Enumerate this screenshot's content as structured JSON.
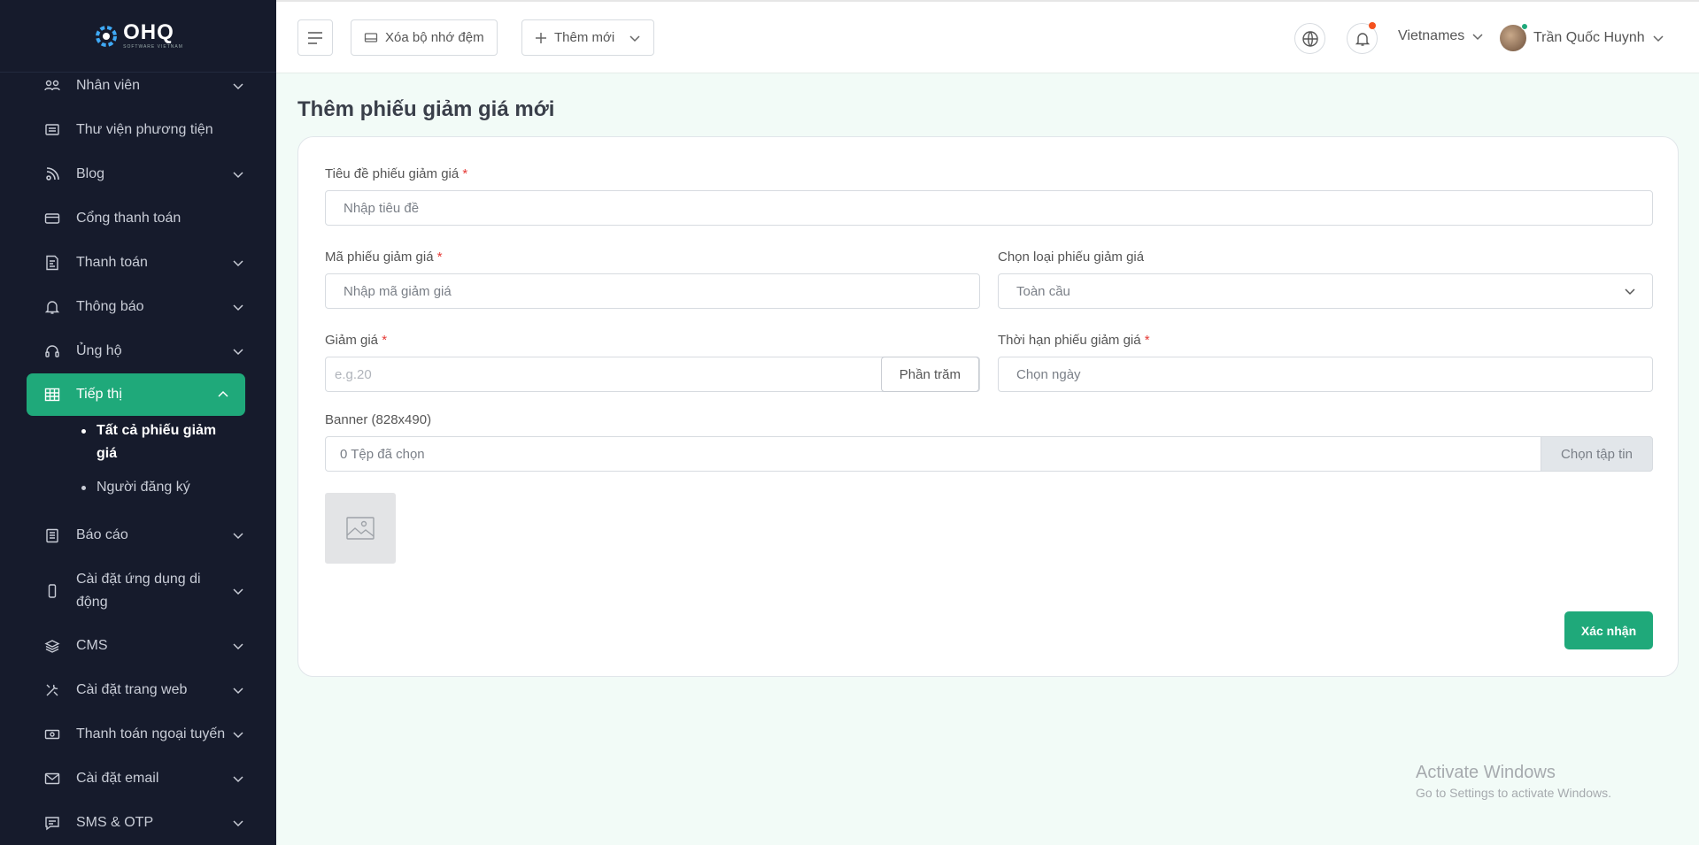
{
  "app": {
    "logo_text": "OHQ",
    "logo_sub": "SOFTWARE VIETNAM"
  },
  "sidebar": {
    "items": [
      {
        "label": "Nhân viên",
        "icon": "users-icon",
        "has_chevron": true
      },
      {
        "label": "Thư viện phương tiện",
        "icon": "media-library-icon",
        "has_chevron": false
      },
      {
        "label": "Blog",
        "icon": "blog-icon",
        "has_chevron": true
      },
      {
        "label": "Cổng thanh toán",
        "icon": "credit-card-icon",
        "has_chevron": false
      },
      {
        "label": "Thanh toán",
        "icon": "invoice-icon",
        "has_chevron": true
      },
      {
        "label": "Thông báo",
        "icon": "bell-icon",
        "has_chevron": true
      },
      {
        "label": "Ủng hộ",
        "icon": "headset-icon",
        "has_chevron": true
      },
      {
        "label": "Tiếp thị",
        "icon": "table-icon",
        "has_chevron": true,
        "active": true
      },
      {
        "label": "Báo cáo",
        "icon": "clipboard-icon",
        "has_chevron": true
      },
      {
        "label": "Cài đặt ứng dụng di động",
        "icon": "mobile-icon",
        "has_chevron": true
      },
      {
        "label": "CMS",
        "icon": "layers-icon",
        "has_chevron": true
      },
      {
        "label": "Cài đặt trang web",
        "icon": "tools-icon",
        "has_chevron": true
      },
      {
        "label": "Thanh toán ngoại tuyến",
        "icon": "cash-icon",
        "has_chevron": true
      },
      {
        "label": "Cài đặt email",
        "icon": "mail-icon",
        "has_chevron": true
      },
      {
        "label": "SMS & OTP",
        "icon": "message-icon",
        "has_chevron": true
      }
    ],
    "submenu": [
      {
        "label": "Tất cả phiếu giảm giá",
        "active": true
      },
      {
        "label": "Người đăng ký",
        "active": false
      }
    ]
  },
  "topbar": {
    "clear_cache_label": "Xóa bộ nhớ đệm",
    "add_new_label": "Thêm mới",
    "language": "Vietnames",
    "user_name": "Trần Quốc Huynh"
  },
  "page": {
    "title": "Thêm phiếu giảm giá mới"
  },
  "form": {
    "title_label": "Tiêu đề phiếu giảm giá",
    "title_placeholder": "Nhập tiêu đề",
    "code_label": "Mã phiếu giảm giá",
    "code_placeholder": "Nhập mã giảm giá",
    "type_label": "Chọn loại phiếu giảm giá",
    "type_value": "Toàn cầu",
    "discount_label": "Giảm giá",
    "discount_placeholder": "e.g.20",
    "discount_unit": "Phần trăm",
    "expiry_label": "Thời hạn phiếu giảm giá",
    "expiry_placeholder": "Chọn ngày",
    "banner_label": "Banner (828x490)",
    "file_status": "0 Tệp đã chọn",
    "file_button": "Chọn tập tin",
    "required_mark": "*",
    "submit_label": "Xác nhận"
  },
  "watermark": {
    "line1": "Activate Windows",
    "line2": "Go to Settings to activate Windows."
  },
  "colors": {
    "sidebar_bg": "#161b2c",
    "accent": "#1fa97a",
    "page_bg": "#f2fbf7"
  }
}
